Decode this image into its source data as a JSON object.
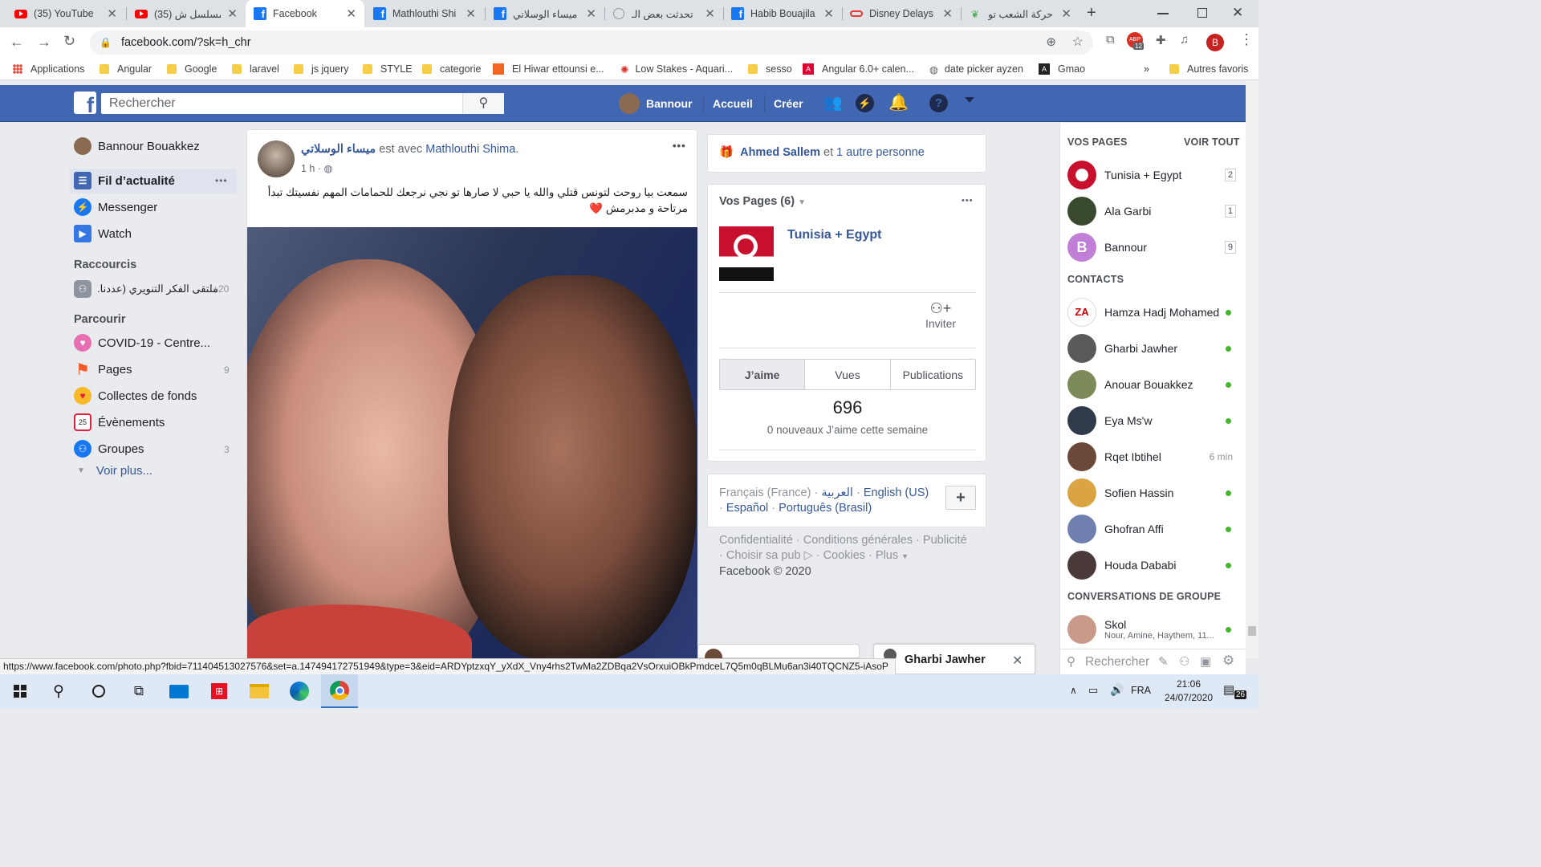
{
  "browser": {
    "tabs": [
      {
        "title": "(35) YouTube",
        "icon": "youtube-icon"
      },
      {
        "title": "(35) مسلسل ش",
        "icon": "youtube-icon"
      },
      {
        "title": "Facebook",
        "icon": "facebook-icon",
        "active": true
      },
      {
        "title": "Mathlouthi Shi",
        "icon": "facebook-icon"
      },
      {
        "title": "ميساء الوسلاتي",
        "icon": "facebook-icon"
      },
      {
        "title": "تحدثت بعض الـ",
        "icon": "news-icon"
      },
      {
        "title": "Habib Bouajila",
        "icon": "facebook-icon"
      },
      {
        "title": "Disney Delays",
        "icon": "news-icon"
      },
      {
        "title": "حركة الشعب تو",
        "icon": "leaf-icon"
      }
    ],
    "new_tab": "+",
    "url": "facebook.com/?sk=h_chr",
    "profile_initial": "B",
    "badge_count": "12",
    "bookmarks": [
      "Applications",
      "Angular",
      "Google",
      "laravel",
      "js jquery",
      "STYLE",
      "categorie",
      "El Hiwar ettounsi e...",
      "Low Stakes - Aquari...",
      "sesso",
      "Angular 6.0+ calen...",
      "date picker ayzen",
      "Gmao"
    ],
    "bookmarks_more": "»",
    "other_bookmarks": "Autres favoris",
    "status_url": "https://www.facebook.com/photo.php?fbid=711404513027576&set=a.147494172751949&type=3&eid=ARDYptzxqY_yXdX_Vny4rhs2TwMa2ZDBqa2VsOrxuiOBkPmdceL7Q5m0qBLMu6an3i40TQCNZ5-iAsoP"
  },
  "fb_header": {
    "search_placeholder": "Rechercher",
    "user": "Bannour",
    "home": "Accueil",
    "create": "Créer"
  },
  "left_nav": {
    "profile_name": "Bannour Bouakkez",
    "items": [
      {
        "label": "Fil d’actualité",
        "icon": "newsfeed-icon",
        "more": "•••"
      },
      {
        "label": "Messenger",
        "icon": "messenger-icon"
      },
      {
        "label": "Watch",
        "icon": "watch-icon"
      }
    ],
    "shortcuts_title": "Raccourcis",
    "shortcut": {
      "label": "ملتقى الفكر التنويري (عددنا...",
      "count": "+20"
    },
    "explore_title": "Parcourir",
    "explore": [
      {
        "label": "COVID-19 - Centre...",
        "icon": "covid-icon",
        "count": ""
      },
      {
        "label": "Pages",
        "icon": "pages-flag-icon",
        "count": "9"
      },
      {
        "label": "Collectes de fonds",
        "icon": "fundraiser-icon",
        "count": ""
      },
      {
        "label": "Évènements",
        "icon": "calendar-icon",
        "count": ""
      },
      {
        "label": "Groupes",
        "icon": "groups-icon",
        "count": "3"
      }
    ],
    "see_more": "Voir plus..."
  },
  "post": {
    "author": "ميساء الوسلاتي",
    "with_text": "est avec",
    "tagged": "Mathlouthi Shima",
    "time": "1 h ·",
    "text": "سمعت بيا روحت لتونس قتلي والله يا حبي لا صارها تو نجي نرجعك للحمامات المهم نفسيتك تبدأ مرتاحة و مدبرمش ❤️",
    "menu": "•••"
  },
  "right_col": {
    "notif_name": "Ahmed Sallem",
    "notif_text": "et",
    "notif_link": "1 autre personne",
    "pages_title": "Vos Pages (6)",
    "page_name": "Tunisia + Egypt",
    "invite": "Inviter",
    "tabs": [
      "J’aime",
      "Vues",
      "Publications"
    ],
    "likes": "696",
    "likes_sub": "0 nouveaux J’aime cette semaine",
    "languages": [
      "Français (France)",
      "العربية",
      "English (US)",
      "Español",
      "Português (Brasil)"
    ],
    "footer_links": [
      "Confidentialité",
      "Conditions générales",
      "Publicité",
      "Choisir sa pub",
      "Cookies",
      "Plus"
    ],
    "copyright": "Facebook © 2020"
  },
  "sidebar": {
    "pages_title": "VOS PAGES",
    "see_all": "VOIR TOUT",
    "pages": [
      {
        "name": "Tunisia + Egypt",
        "count": "2",
        "color": "#c8102e"
      },
      {
        "name": "Ala Garbi",
        "count": "1",
        "color": "#3a4a2e"
      },
      {
        "name": "Bannour",
        "count": "9",
        "color": "#c17ed6"
      }
    ],
    "contacts_title": "CONTACTS",
    "contacts": [
      {
        "name": "Hamza Hadj Mohamed",
        "status": "online",
        "color": "#ffffff"
      },
      {
        "name": "Gharbi Jawher",
        "status": "online",
        "color": "#5a5a5a"
      },
      {
        "name": "Anouar Bouakkez",
        "status": "online",
        "color": "#7d8a5a"
      },
      {
        "name": "Eya Ms'w",
        "status": "online",
        "color": "#2f3b4a"
      },
      {
        "name": "Rqet Ibtihel",
        "status": "6 min",
        "color": "#6b4a3a"
      },
      {
        "name": "Sofien Hassin",
        "status": "online",
        "color": "#d9a441"
      },
      {
        "name": "Ghofran Affi",
        "status": "online",
        "color": "#6e7fb0"
      },
      {
        "name": "Houda Dababi",
        "status": "online",
        "color": "#4a3a3a"
      }
    ],
    "group_title": "CONVERSATIONS DE GROUPE",
    "group": {
      "name": "Skol",
      "members": "Nour, Amine, Haythem, 11..."
    },
    "search_placeholder": "Rechercher"
  },
  "chat": {
    "name": "Gharbi Jawher",
    "close": "✕"
  },
  "taskbar": {
    "lang": "FRA",
    "time": "21:06",
    "date": "24/07/2020",
    "notif": "26"
  }
}
